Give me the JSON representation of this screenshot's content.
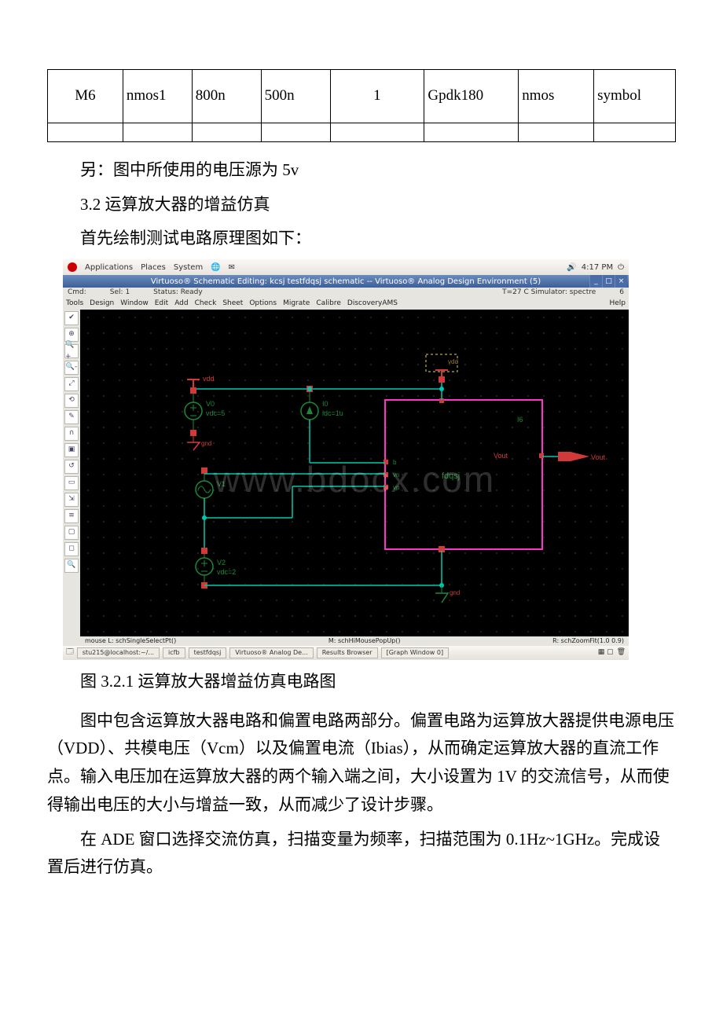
{
  "table": {
    "row": {
      "c1": "M6",
      "c2": "nmos1",
      "c3": "800n",
      "c4": "500n",
      "c5": "1",
      "c6": "Gpdk180",
      "c7": "nmos",
      "c8": "symbol"
    }
  },
  "text": {
    "note": "另：图中所使用的电压源为 5v",
    "sec32": "3.2 运算放大器的增益仿真",
    "intro": "首先绘制测试电路原理图如下：",
    "caption": "图 3.2.1 运算放大器增益仿真电路图",
    "para1": "图中包含运算放大器电路和偏置电路两部分。偏置电路为运算放大器提供电源电压（VDD）、共模电压（Vcm）以及偏置电流（Ibias），从而确定运算放大器的直流工作点。输入电压加在运算放大器的两个输入端之间，大小设置为 1V 的交流信号，从而使得输出电压的大小与增益一致，从而减少了设计步骤。",
    "para2": "在 ADE 窗口选择交流仿真，扫描变量为频率，扫描范围为 0.1Hz~1GHz。完成设置后进行仿真。"
  },
  "shot": {
    "gnome": {
      "apps": "Applications",
      "places": "Places",
      "system": "System",
      "clock": "4:17 PM",
      "vol_icon": "speaker-icon"
    },
    "title": "Virtuoso® Schematic Editing: kcsj testfdqsj schematic -- Virtuoso® Analog Design Environment (5)",
    "status": {
      "cmd": "Cmd:",
      "sel": "Sel: 1",
      "status": "Status: Ready",
      "sim": "T=27 C  Simulator: spectre",
      "n": "6"
    },
    "menu": [
      "Tools",
      "Design",
      "Window",
      "Edit",
      "Add",
      "Check",
      "Sheet",
      "Options",
      "Migrate",
      "Calibre",
      "DiscoveryAMS"
    ],
    "help": "Help",
    "tool_icons": [
      "✔",
      "⊕",
      "🔍+",
      "🔍-",
      "⤢",
      "⟲",
      "✎",
      "∩",
      "▣",
      "↺",
      "▭",
      "⇲",
      "≡",
      "▢",
      "◻",
      "🔍"
    ],
    "mouse": {
      "l": "mouse L: schSingleSelectPt()",
      "m": "M: schHiMousePopUp()",
      "r": "R: schZoomFit(1.0 0.9)"
    },
    "taskbar": [
      "stu215@localhost:~/...",
      "icfb",
      "testfdqsj",
      "Virtuoso® Analog De...",
      "Results Browser",
      "[Graph Window 0]"
    ],
    "sch": {
      "vdd_label": "vdd",
      "v0": "V0",
      "vdc5": "vdc=5",
      "gnd": "gnd",
      "i0": "I0",
      "idc": "idc=1u",
      "v1": "V1",
      "v2": "V2",
      "vdc2": "vdc=2",
      "block": "fdqsj",
      "b": "b",
      "vn": "vn",
      "vp": "vp",
      "i6": "I6",
      "vout": "Vout",
      "vout2": "Vout",
      "gnd2": "gnd",
      "watermark": "www.bdocx.com"
    }
  }
}
